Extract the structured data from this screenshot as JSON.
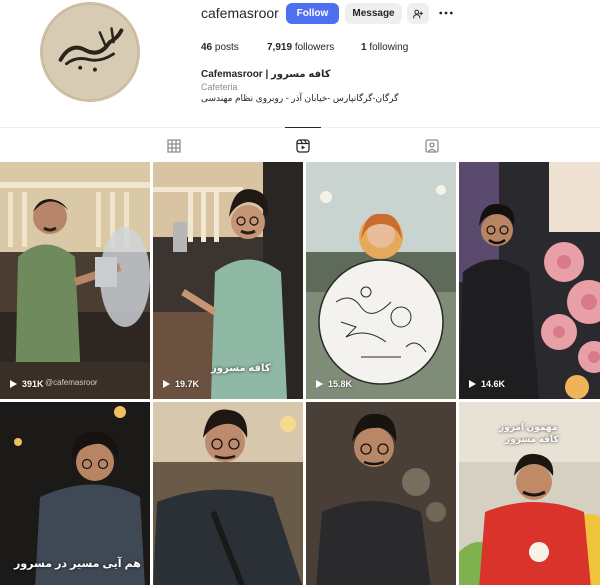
{
  "profile": {
    "username": "cafemasroor",
    "follow_label": "Follow",
    "message_label": "Message",
    "avatar_logo_text": "کافه مسرور",
    "posts_count": "46",
    "posts_label": "posts",
    "followers_count": "7,919",
    "followers_label": "followers",
    "following_count": "1",
    "following_label": "following",
    "full_name": "Cafemasroor | کافه مسرور",
    "category": "Cafeteria",
    "bio": "گرگان-گرگانپارس -خیابان آذر - روبروی نظام مهندسی"
  },
  "icons": {
    "suggest": "add-person-icon",
    "more": "more-icon",
    "posts_tab": "grid-icon",
    "reels_tab": "reels-icon",
    "tagged_tab": "tagged-icon",
    "views": "play-icon"
  },
  "colors": {
    "follow_button": "#4f6ff1",
    "secondary_button": "#efefef",
    "muted_text": "#8e8e8e"
  },
  "reels": [
    {
      "views": "391K",
      "watermark": "@cafemasroor"
    },
    {
      "views": "19.7K",
      "caption": "کافه مسرور"
    },
    {
      "views": "15.8K"
    },
    {
      "views": "14.6K"
    },
    {
      "caption": "هم آیی مسیر در مسرور"
    },
    {},
    {},
    {
      "caption_line1": "مهمون امروز",
      "caption_line2": "کافه مسرور"
    }
  ]
}
